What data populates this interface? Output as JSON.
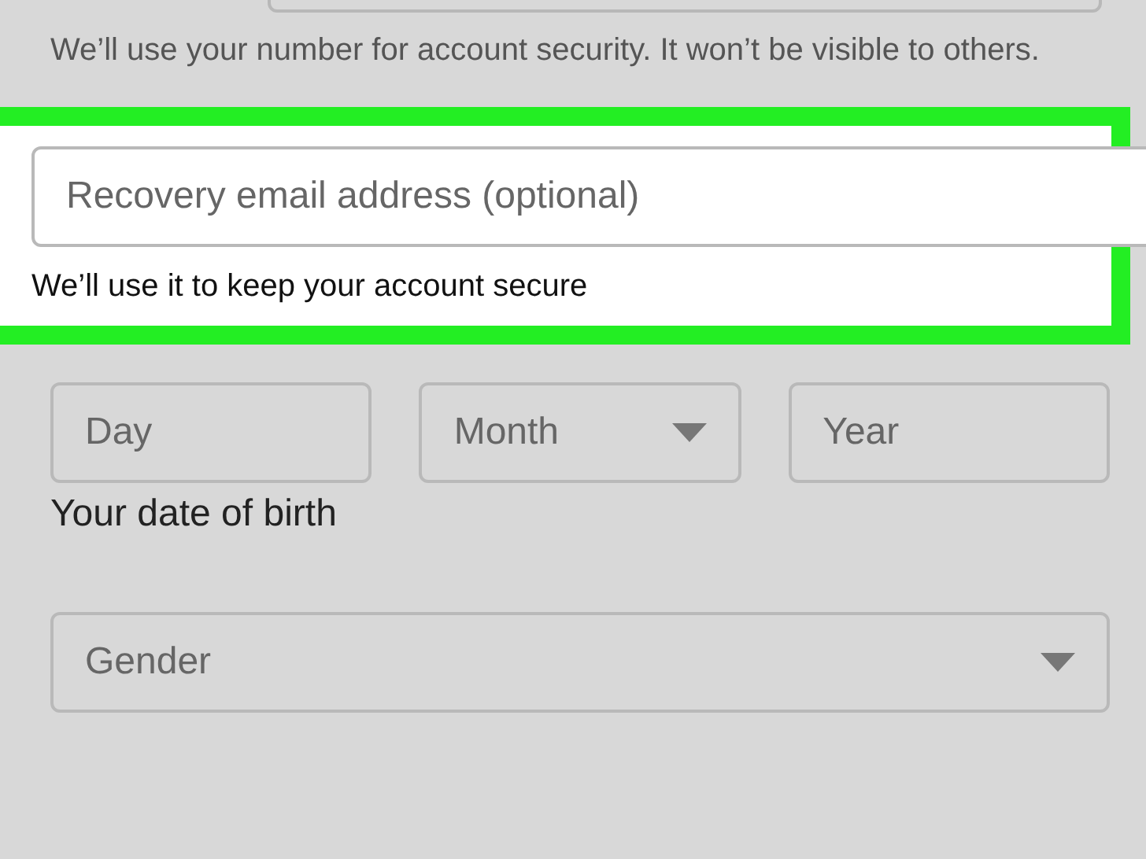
{
  "phone_note": "We’ll use your number for account security. It won’t be visible to others.",
  "recovery_email": {
    "placeholder": "Recovery email address (optional)",
    "hint": "We’ll use it to keep your account secure",
    "highlighted": true
  },
  "birth_date": {
    "fields": [
      {
        "placeholder": "Day",
        "kind": "text"
      },
      {
        "placeholder": "Month",
        "kind": "select"
      },
      {
        "placeholder": "Year",
        "kind": "text"
      }
    ],
    "label": "Your date of birth"
  },
  "gender": {
    "placeholder": "Gender",
    "kind": "select"
  }
}
